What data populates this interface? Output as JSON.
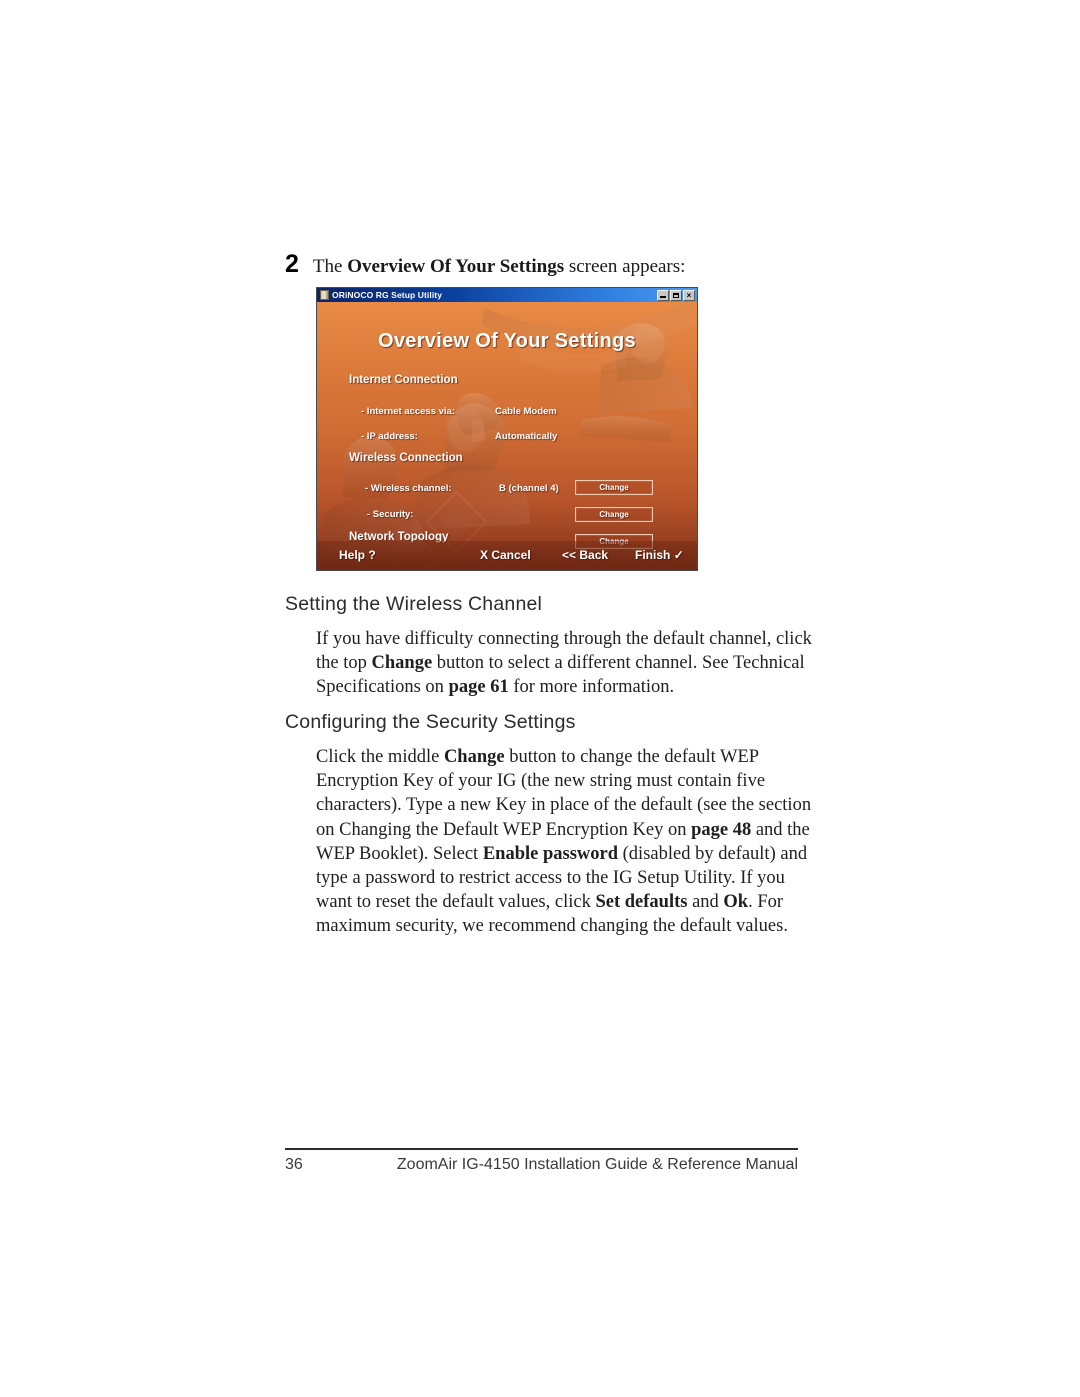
{
  "page": {
    "number": "36",
    "footer_title": "ZoomAir IG-4150 Installation Guide & Reference Manual"
  },
  "step": {
    "number": "2",
    "text_before": "The ",
    "text_bold": "Overview Of Your Settings",
    "text_after": " screen appears:"
  },
  "screenshot": {
    "window_title": "ORiNOCO RG Setup Utility",
    "window_buttons": {
      "minimize": "minimize-icon",
      "maximize": "maximize-icon",
      "close": "×"
    },
    "wizard_title": "Overview Of Your Settings",
    "sections": [
      {
        "heading": "Internet Connection",
        "rows": [
          {
            "label": "- Internet access via:",
            "value": "Cable Modem",
            "button": ""
          },
          {
            "label": "- IP address:",
            "value": "Automatically",
            "button": ""
          }
        ]
      },
      {
        "heading": "Wireless Connection",
        "rows": [
          {
            "label": "- Wireless channel:",
            "value": "B (channel 4)",
            "button": "Change"
          },
          {
            "label": "- Security:",
            "value": "",
            "button": "Change"
          }
        ]
      },
      {
        "heading": "Network Topology",
        "rows": [
          {
            "label": "",
            "value": "",
            "button": "Change"
          }
        ]
      }
    ],
    "footer_buttons": {
      "help": "Help ?",
      "cancel": "X Cancel",
      "back": "<< Back",
      "finish": "Finish",
      "finish_check": "✓"
    },
    "colors": {
      "title_bar_start": "#0a246a",
      "title_bar_end": "#4f9bf0",
      "body_top": "#e98a46",
      "body_bottom": "#7e3119",
      "button_border": "#f0cdb2",
      "text": "#ffffff"
    }
  },
  "sections": {
    "wireless_channel": {
      "heading": "Setting the Wireless Channel",
      "paragraph": {
        "part1": "If you have difficulty connecting through the default channel, click the top ",
        "bold1": "Change",
        "part2": " button to select a different channel. See Technical Specifications on ",
        "bold2": "page 61",
        "part3": " for more information."
      }
    },
    "security_settings": {
      "heading": "Configuring the Security Settings",
      "paragraph": {
        "part1": "Click the middle ",
        "bold1": "Change",
        "part2": " button to change the default WEP Encryption Key of your IG (the new string must contain five characters). Type a new Key in place of the default (see the section on Changing the Default WEP Encryption Key on ",
        "bold2": "page 48",
        "part3": " and the WEP Booklet). Select ",
        "bold3": "Enable password",
        "part4": " (disabled by default) and type a password to restrict access to the IG Setup Utility. If you want to reset the default values, click ",
        "bold4": "Set defaults",
        "part5": " and ",
        "bold5": "Ok",
        "part6": ". For maximum security, we recommend changing the default values."
      }
    }
  }
}
